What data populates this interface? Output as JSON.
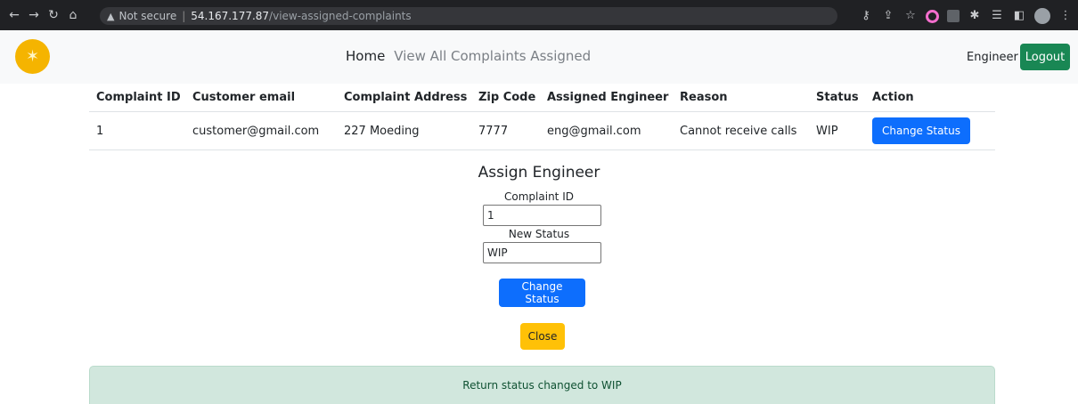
{
  "browser": {
    "security_label": "Not secure",
    "host": "54.167.177.87",
    "path": "/view-assigned-complaints"
  },
  "navbar": {
    "logo_icon": "satellite-icon",
    "home_label": "Home",
    "view_label": "View All Complaints Assigned",
    "role_label": "Engineer",
    "logout_label": "Logout"
  },
  "table": {
    "headers": [
      "Complaint ID",
      "Customer email",
      "Complaint Address",
      "Zip Code",
      "Assigned Engineer",
      "Reason",
      "Status",
      "Action"
    ],
    "rows": [
      {
        "id": "1",
        "email": "customer@gmail.com",
        "address": "227 Moeding",
        "zip": "7777",
        "engineer": "eng@gmail.com",
        "reason": "Cannot receive calls",
        "status": "WIP",
        "action_label": "Change Status"
      }
    ]
  },
  "form": {
    "title": "Assign Engineer",
    "complaint_id_label": "Complaint ID",
    "complaint_id_value": "1",
    "new_status_label": "New Status",
    "new_status_value": "WIP",
    "submit_label": "Change Status",
    "close_label": "Close"
  },
  "alert": {
    "message": "Return status changed to WIP"
  },
  "colors": {
    "primary": "#0d6efd",
    "success": "#198754",
    "warning": "#ffc107",
    "alert_bg": "#d1e7dd",
    "logo": "#f5b400"
  }
}
